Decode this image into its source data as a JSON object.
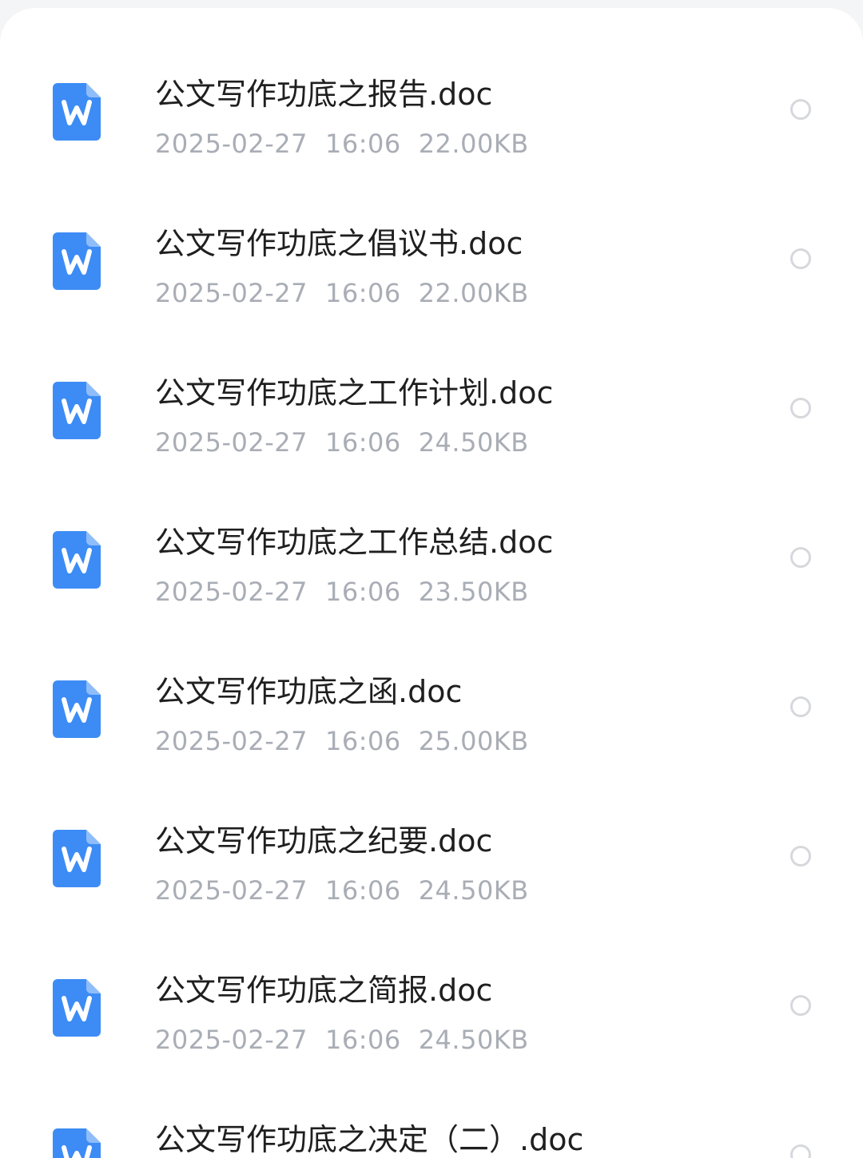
{
  "colors": {
    "page_background": "#f4f5f7",
    "sheet_background": "#ffffff",
    "word_icon_blue": "#3d8cf5",
    "title_text": "#1f1f1f",
    "meta_text": "#a9adb5",
    "radio_border": "#d6d8dc"
  },
  "files": [
    {
      "name": "公文写作功底之报告.doc",
      "date": "2025-02-27",
      "time": "16:06",
      "size": "22.00KB",
      "icon": "word-doc-icon",
      "selected": false
    },
    {
      "name": "公文写作功底之倡议书.doc",
      "date": "2025-02-27",
      "time": "16:06",
      "size": "22.00KB",
      "icon": "word-doc-icon",
      "selected": false
    },
    {
      "name": "公文写作功底之工作计划.doc",
      "date": "2025-02-27",
      "time": "16:06",
      "size": "24.50KB",
      "icon": "word-doc-icon",
      "selected": false
    },
    {
      "name": "公文写作功底之工作总结.doc",
      "date": "2025-02-27",
      "time": "16:06",
      "size": "23.50KB",
      "icon": "word-doc-icon",
      "selected": false
    },
    {
      "name": "公文写作功底之函.doc",
      "date": "2025-02-27",
      "time": "16:06",
      "size": "25.00KB",
      "icon": "word-doc-icon",
      "selected": false
    },
    {
      "name": "公文写作功底之纪要.doc",
      "date": "2025-02-27",
      "time": "16:06",
      "size": "24.50KB",
      "icon": "word-doc-icon",
      "selected": false
    },
    {
      "name": "公文写作功底之简报.doc",
      "date": "2025-02-27",
      "time": "16:06",
      "size": "24.50KB",
      "icon": "word-doc-icon",
      "selected": false
    },
    {
      "name": "公文写作功底之决定（二）.doc",
      "date": "",
      "time": "",
      "size": "",
      "icon": "word-doc-icon",
      "selected": false
    }
  ]
}
